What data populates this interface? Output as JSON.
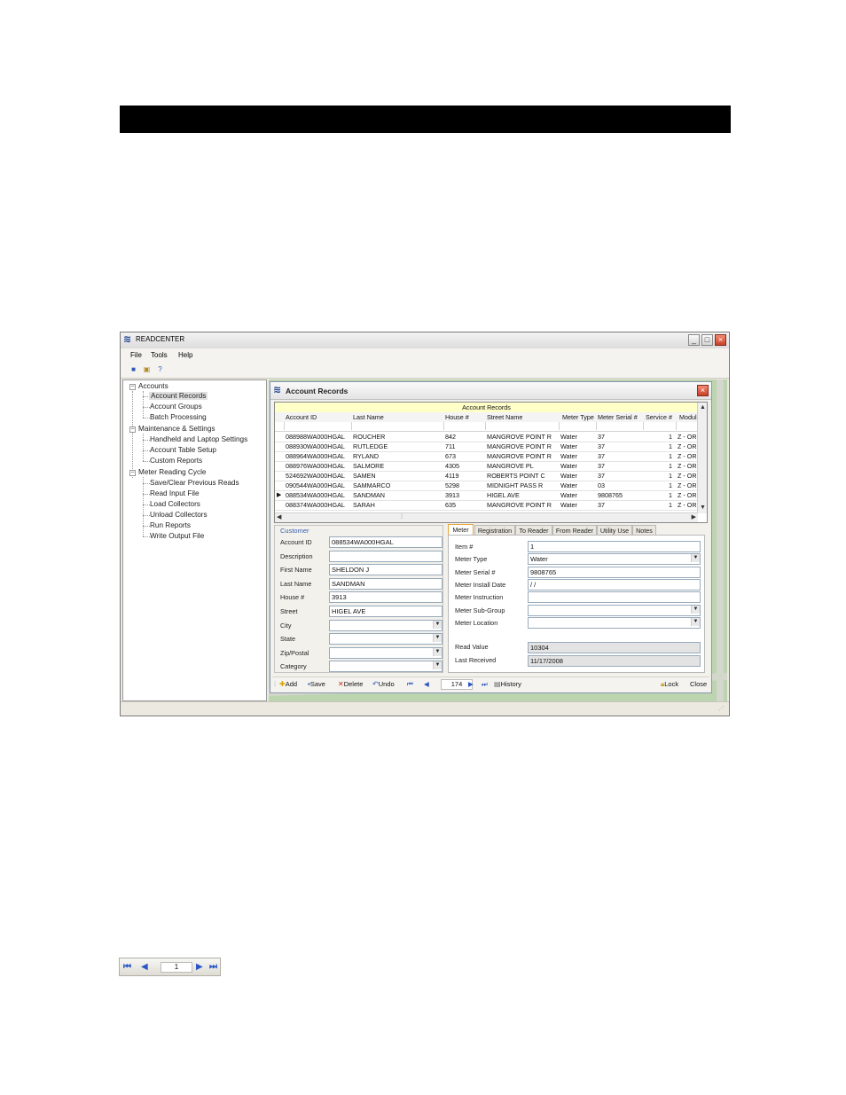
{
  "window": {
    "title": "READCENTER",
    "controls": [
      "_",
      "□",
      "×"
    ]
  },
  "menu": [
    "File",
    "Tools",
    "Help"
  ],
  "toolbar_icons": [
    "square-icon",
    "folder-icon",
    "help-icon"
  ],
  "tree": {
    "groups": [
      {
        "label": "Accounts",
        "items": [
          "Account Records",
          "Account Groups",
          "Batch Processing"
        ]
      },
      {
        "label": "Maintenance & Settings",
        "items": [
          "Handheld and Laptop Settings",
          "Account Table Setup",
          "Custom Reports"
        ]
      },
      {
        "label": "Meter Reading Cycle",
        "items": [
          "Save/Clear Previous Reads",
          "Read Input File",
          "Load Collectors",
          "Unload Collectors",
          "Run Reports",
          "Write Output File"
        ]
      }
    ],
    "selected": "Account Records"
  },
  "child": {
    "title": "Account Records",
    "grid": {
      "caption": "Account Records",
      "columns": [
        "Account ID",
        "Last Name",
        "House #",
        "Street Name",
        "Meter Type",
        "Meter Serial #",
        "Service #",
        "Module"
      ],
      "rows": [
        [
          "088988WA000HGAL",
          "ROUCHER",
          "842",
          "MANGROVE POINT R",
          "Water",
          "37",
          "1",
          "Z - ORIC"
        ],
        [
          "088930WA000HGAL",
          "RUTLEDGE",
          "711",
          "MANGROVE POINT R",
          "Water",
          "37",
          "1",
          "Z - ORIC"
        ],
        [
          "088964WA000HGAL",
          "RYLAND",
          "673",
          "MANGROVE POINT R",
          "Water",
          "37",
          "1",
          "Z - ORIC"
        ],
        [
          "088976WA000HGAL",
          "SALMORE",
          "4305",
          "MANGROVE PL",
          "Water",
          "37",
          "1",
          "Z - ORIC"
        ],
        [
          "524692WA000HGAL",
          "SAMEN",
          "4119",
          "ROBERTS POINT C",
          "Water",
          "37",
          "1",
          "Z - ORIC"
        ],
        [
          "090544WA000HGAL",
          "SAMMARCO",
          "5298",
          "MIDNIGHT PASS R",
          "Water",
          "03",
          "1",
          "Z - ORIC"
        ],
        [
          "088534WA000HGAL",
          "SANDMAN",
          "3913",
          "HIGEL AVE",
          "Water",
          "9808765",
          "1",
          "Z - ORIC"
        ],
        [
          "088374WA000HGAL",
          "SARAH",
          "635",
          "MANGROVE POINT R",
          "Water",
          "37",
          "1",
          "Z - ORIC"
        ]
      ],
      "current_row": 6
    },
    "customer": {
      "legend": "Customer",
      "fields": [
        {
          "label": "Account ID",
          "value": "088534WA000HGAL"
        },
        {
          "label": "Description",
          "value": ""
        },
        {
          "label": "First Name",
          "value": "SHELDON J"
        },
        {
          "label": "Last Name",
          "value": "SANDMAN"
        },
        {
          "label": "House #",
          "value": "3913"
        },
        {
          "label": "Street",
          "value": "HIGEL AVE"
        },
        {
          "label": "City",
          "value": ""
        },
        {
          "label": "State",
          "value": ""
        },
        {
          "label": "Zip/Postal",
          "value": ""
        },
        {
          "label": "Category",
          "value": ""
        }
      ]
    },
    "tabs": [
      "Meter",
      "Registration",
      "To Reader",
      "From Reader",
      "Utility Use",
      "Notes"
    ],
    "active_tab": "Meter",
    "meter": {
      "fields": [
        {
          "label": "Item #",
          "value": "1"
        },
        {
          "label": "Meter Type",
          "value": "Water"
        },
        {
          "label": "Meter Serial #",
          "value": "9808765"
        },
        {
          "label": "Meter Install Date",
          "value": " / /"
        },
        {
          "label": "Meter Instruction",
          "value": ""
        },
        {
          "label": "Meter Sub-Group",
          "value": ""
        },
        {
          "label": "Meter Location",
          "value": ""
        }
      ],
      "readonly": [
        {
          "label": "Read Value",
          "value": "10304"
        },
        {
          "label": "Last Received",
          "value": "11/17/2008"
        }
      ]
    },
    "navbar": {
      "add": "Add",
      "save": "Save",
      "delete": "Delete",
      "undo": "Undo",
      "position": "174",
      "history": "History",
      "lock": "Lock",
      "close": "Close"
    }
  },
  "mini_nav": {
    "position": "1"
  }
}
